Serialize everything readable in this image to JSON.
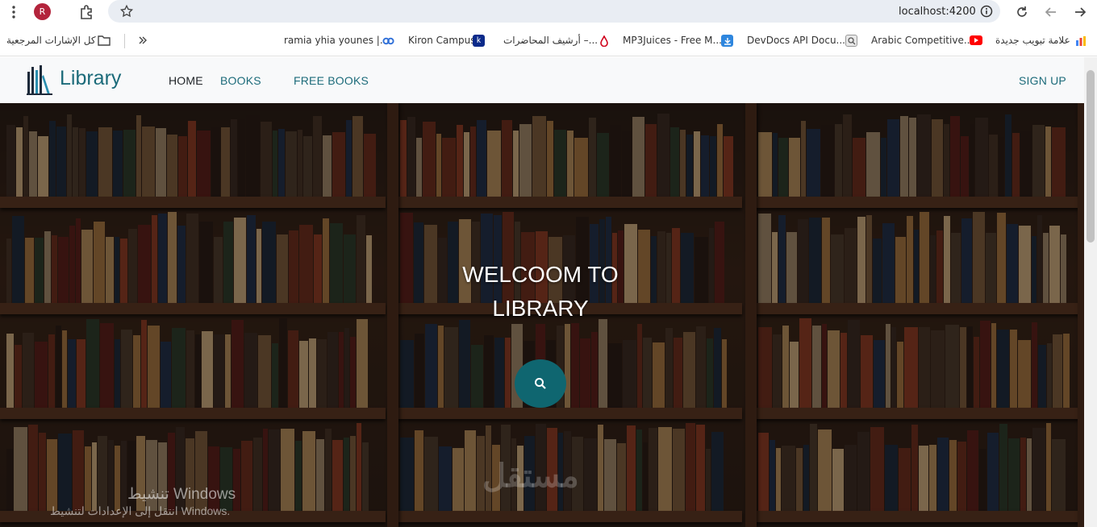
{
  "browser": {
    "avatar_letter": "R",
    "url": "localhost:4200",
    "icons": [
      "menu-dots-icon",
      "extensions-icon",
      "star-icon",
      "site-info-icon",
      "reload-icon",
      "back-icon",
      "forward-icon"
    ]
  },
  "bookmarks": {
    "all_bookmarks": "كل الإشارات المرجعية",
    "items": [
      {
        "label": "ramia yhia younes |...",
        "icon": "link-icon"
      },
      {
        "label": "Kiron Campus",
        "icon": "kiron-icon"
      },
      {
        "label": "أرشيف المحاضرات –...",
        "icon": "drop-icon"
      },
      {
        "label": "MP3Juices - Free M...",
        "icon": "download-icon"
      },
      {
        "label": "DevDocs API Docu...",
        "icon": "search-box-icon"
      },
      {
        "label": "Arabic Competitive...",
        "icon": "youtube-icon"
      },
      {
        "label": "علامة تبويب جديدة",
        "icon": "bars-icon"
      }
    ],
    "colors": {
      "kiron": "#0b2a8a",
      "drop": "#d0021b",
      "download": "#2e86de",
      "youtube": "#ff0000"
    }
  },
  "navbar": {
    "brand": "Library",
    "links": [
      "HOME",
      "BOOKS",
      "FREE BOOKS"
    ],
    "signup": "SIGN UP",
    "accent": "#1c6b7a"
  },
  "hero": {
    "title_line1": "WELCOOM TO",
    "title_line2": "LIBRARY",
    "search_button_color": "#0f6670"
  },
  "watermark": {
    "activate_title": "تنشيط Windows",
    "activate_sub": "انتقل إلى الإعدادات لتنشيط Windows.",
    "site_logo": "مستقل"
  }
}
